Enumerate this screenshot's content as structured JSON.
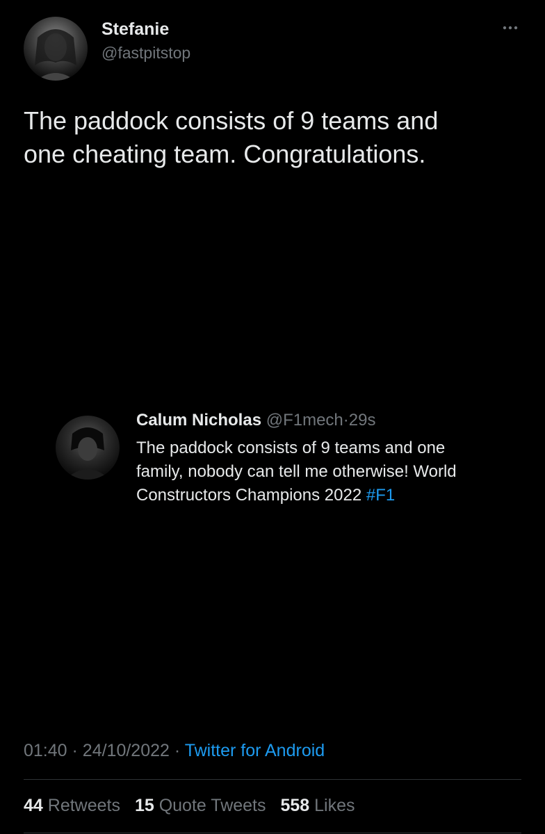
{
  "tweet": {
    "display_name": "Stefanie",
    "handle": "@fastpitstop",
    "text_lines": [
      "The paddock consists of 9 teams and",
      "one cheating team. Congratulations."
    ],
    "more_icon": "more-horizontal-icon"
  },
  "quoted": {
    "display_name": "Calum Nicholas",
    "handle": "@F1mech",
    "separator": "·",
    "time": "29s",
    "lines": [
      "The paddock consists of 9 teams and one",
      "family, nobody can tell me otherwise! World",
      "Constructors Champions 2022 "
    ],
    "hashtag": "#F1"
  },
  "meta": {
    "time": "01:40",
    "sep1": "·",
    "date": "24/10/2022",
    "sep2": "·",
    "source": "Twitter for Android"
  },
  "stats": {
    "retweets_count": "44",
    "retweets_label": "Retweets",
    "quotes_count": "15",
    "quotes_label": "Quote Tweets",
    "likes_count": "558",
    "likes_label": "Likes"
  },
  "colors": {
    "background": "#000000",
    "text_primary": "#e7e9ea",
    "text_secondary": "#71767b",
    "accent": "#1d9bf0",
    "divider": "#2f3336"
  }
}
